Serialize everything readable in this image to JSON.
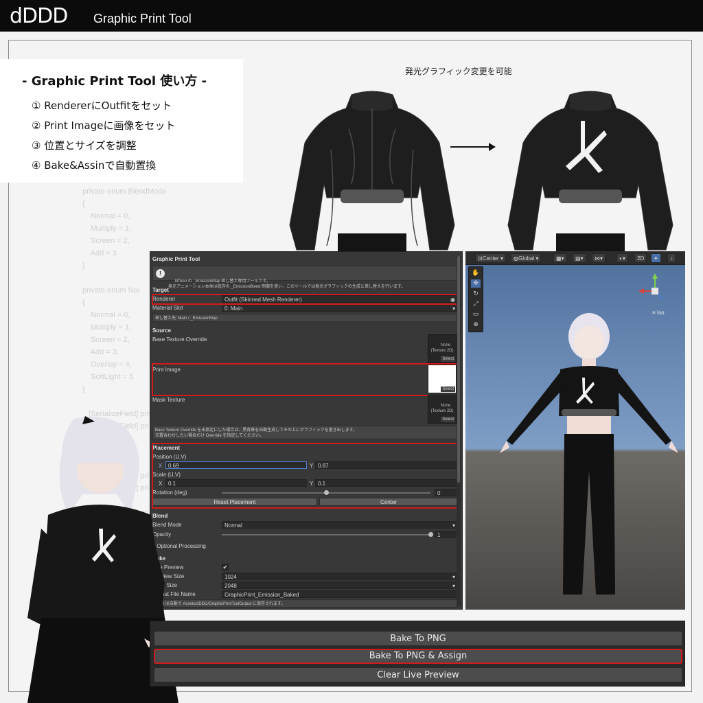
{
  "header": {
    "brand": "dDDD",
    "subtitle": "Graphic Print Tool"
  },
  "howto": {
    "title": "- Graphic Print Tool 使い方 -",
    "steps": [
      "① RendererにOutfitをセット",
      "② Print Imageに画像をセット",
      "③ 位置とサイズを調整",
      "④ Bake&Assinで自動置換"
    ]
  },
  "comparison": {
    "caption": "発光グラフィック変更を可能"
  },
  "code_backdrop": "                               Tool\";\n                            D/GraphicPrintTool\n                            dden/PrintComp\n                            ssionMap\";\n\nprivate enum BlendMode\n{\n    Normal = 0,\n    Multiply = 1,\n    Screen = 2,\n    Add = 3\n}\n\nprivate enum Noi\n{\n    Normal = 0,\n    Multiply = 1,\n    Screen = 2,\n    Add = 3,\n    Overlay = 4,\n    SoftLight = 5\n}\n\n   [SerializeField] priv\n   [SerializeField] pri\n\n\n\n   [SerializeField] pri\n   [SerializeField] pri\n\n   [SerializeField] pri\n\n\n\n\n   [SerializeField] pri\n\n\n\n\n   [SerializeField] pri\n   [SerializeField] pri\n   [SerializeField] pri\n   [SerializeField] private NoiseBlend noiseBlend = NoiseBlend.Overlay;",
  "editor": {
    "title": "Graphic Print Tool",
    "intro": "lilToon の _EmissionMap 差し替え専用ツールです。\n発光アニメーション本体は既存の _EmissionBlend 制御を使い、このツールでは発光グラフィックの生成と差し替えを行います。",
    "target": {
      "section": "Target",
      "renderer_label": "Renderer",
      "renderer_value": "Outfit (Skinned Mesh Renderer)",
      "material_slot_label": "Material Slot",
      "material_slot_value": "0: Main",
      "replace_info": "差し替え先: Main / _EmissionMap"
    },
    "source": {
      "section": "Source",
      "base_texture_label": "Base Texture Override",
      "base_texture_thumb": "None\n(Texture 2D)",
      "print_image_label": "Print Image",
      "mask_texture_label": "Mask Texture",
      "mask_texture_thumb": "None\n(Texture 2D)",
      "select_label": "Select",
      "help": "Base Texture Override を未指定にした場合は、黒背景を自動生成してその上にグラフィックを書き出します。\n位置合わせしたい場合だけ Override を指定してください。"
    },
    "placement": {
      "section": "Placement",
      "position_label": "Position (U,V)",
      "position_x": "0.69",
      "position_y": "0.87",
      "scale_label": "Scale (U,V)",
      "scale_x": "0.1",
      "scale_y": "0.1",
      "x_label": "X",
      "y_label": "Y",
      "rotation_label": "Rotation (deg)",
      "rotation_value": "0",
      "rotation_fraction": 0.5,
      "reset_button": "Reset Placement",
      "center_button": "Center"
    },
    "blend": {
      "section": "Blend",
      "mode_label": "Blend Mode",
      "mode_value": "Normal",
      "opacity_label": "Opacity",
      "opacity_value": "1",
      "opacity_fraction": 1.0,
      "optional_processing": "Optional Processing"
    },
    "bake": {
      "section": "Bake",
      "live_preview_label": "Live Preview",
      "live_preview_checked": true,
      "preview_size_label": "Preview Size",
      "preview_size_value": "1024",
      "bake_size_label": "Bake Size",
      "bake_size_value": "2048",
      "output_file_label": "Output File Name",
      "output_file_value": "GraphicPrint_Emission_Baked",
      "save_info": "PNG は自動で Assets/dDDD/GraphicPrintToolOutput に保存されます。"
    }
  },
  "scene_toolbar": {
    "center": "Center",
    "global": "Global",
    "mode_2d": "2D",
    "iso": "Iso"
  },
  "bake_panel": {
    "bake_png": "Bake To PNG",
    "bake_assign": "Bake To PNG & Assign",
    "clear_preview": "Clear Live Preview"
  },
  "colors": {
    "highlight": "#d11a1a",
    "editor_bg": "#383838",
    "sky": "#7f9ec6"
  }
}
